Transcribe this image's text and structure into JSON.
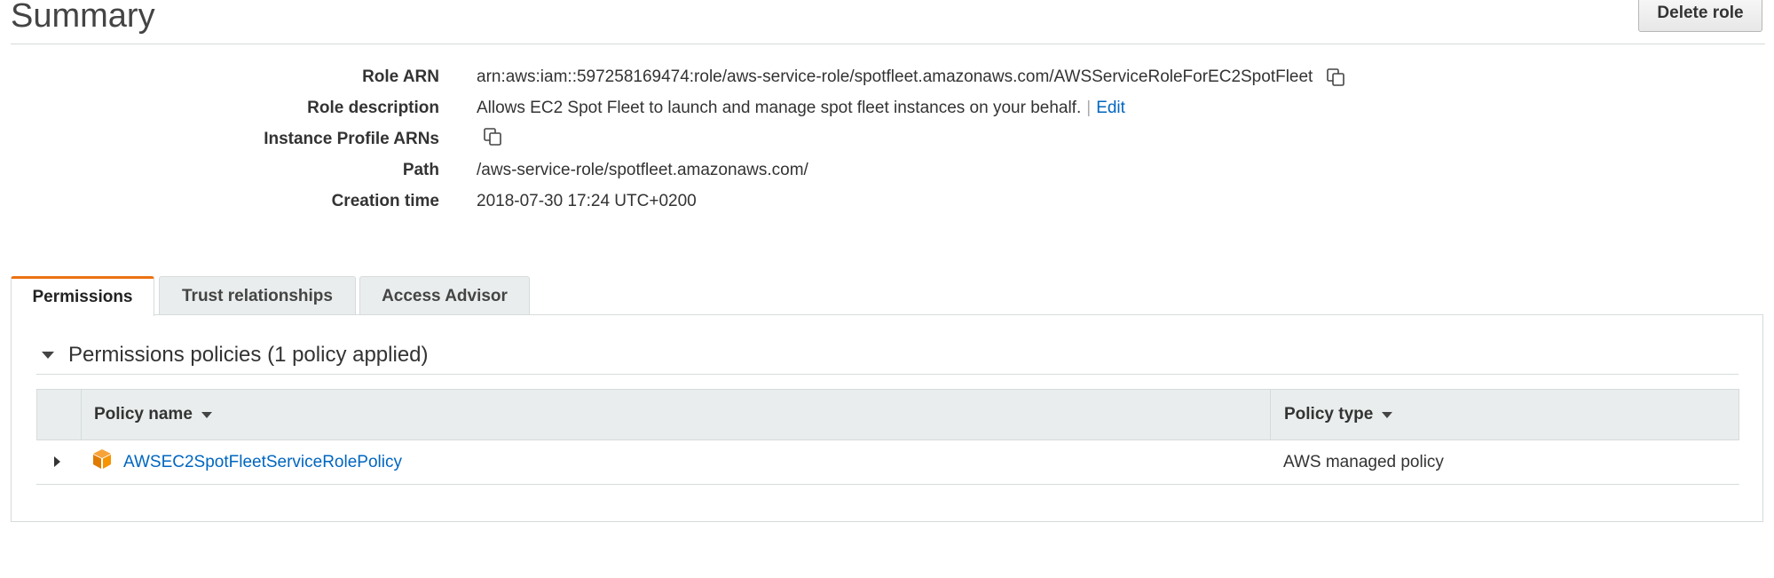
{
  "header": {
    "title": "Summary",
    "delete_label": "Delete role"
  },
  "summary": {
    "role_arn": {
      "label": "Role ARN",
      "value": "arn:aws:iam::597258169474:role/aws-service-role/spotfleet.amazonaws.com/AWSServiceRoleForEC2SpotFleet"
    },
    "role_description": {
      "label": "Role description",
      "value": "Allows EC2 Spot Fleet to launch and manage spot fleet instances on your behalf.",
      "separator": "|",
      "edit_label": "Edit"
    },
    "instance_profile_arns": {
      "label": "Instance Profile ARNs"
    },
    "path": {
      "label": "Path",
      "value": "/aws-service-role/spotfleet.amazonaws.com/"
    },
    "creation_time": {
      "label": "Creation time",
      "value": "2018-07-30 17:24 UTC+0200"
    }
  },
  "tabs": [
    {
      "label": "Permissions",
      "active": true
    },
    {
      "label": "Trust relationships",
      "active": false
    },
    {
      "label": "Access Advisor",
      "active": false
    }
  ],
  "permissions": {
    "section_title": "Permissions policies (1 policy applied)",
    "columns": [
      "Policy name",
      "Policy type"
    ],
    "rows": [
      {
        "name": "AWSEC2SpotFleetServiceRolePolicy",
        "type": "AWS managed policy",
        "icon": "aws-managed-policy-cube-icon"
      }
    ]
  },
  "colors": {
    "link": "#0066c0",
    "active_tab_accent": "#ec7211",
    "policy_icon": "#f79400",
    "header_bg": "#eaeded"
  }
}
